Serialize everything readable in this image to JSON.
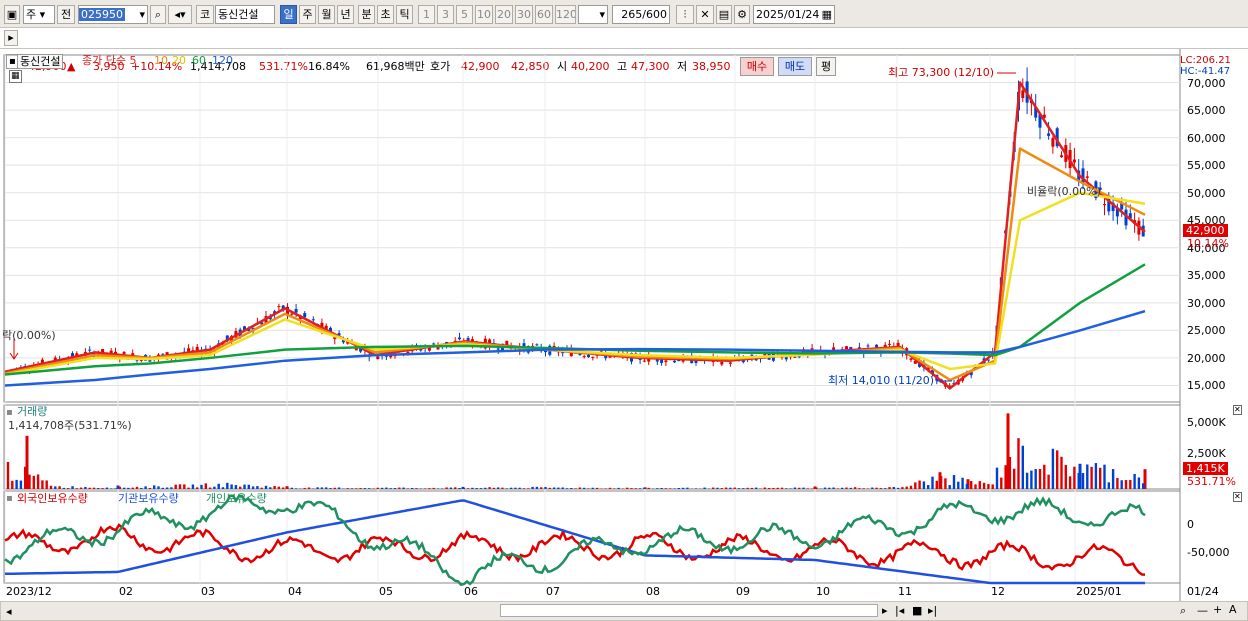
{
  "toolbar": {
    "market": "주",
    "prev_label": "전",
    "code": "025950",
    "exchange_label": "코",
    "stock_name": "동신건설",
    "periods": [
      "일",
      "주",
      "월",
      "년",
      "분",
      "초",
      "틱"
    ],
    "selected_period": "일",
    "intervals": [
      "1",
      "3",
      "5",
      "10",
      "20",
      "30",
      "60",
      "120"
    ],
    "count": "265",
    "count_total": "/600",
    "date": "2025/01/24"
  },
  "quote": {
    "price": "42,900",
    "change": "3,950",
    "change_pct": "+10.14%",
    "volume": "1,414,708",
    "volume_ratio": "531.71%",
    "turnover": "16.84%",
    "amount": "61,968백만",
    "ask_label": "호가",
    "ask": "42,900",
    "bid": "42,850",
    "open_label": "시",
    "open": "40,200",
    "high_label": "고",
    "high": "47,300",
    "low_label": "저",
    "low": "38,950",
    "buy_label": "매수",
    "sell_label": "매도",
    "eval_label": "평"
  },
  "price_panel": {
    "title": "동신건설",
    "ma_label": "종가 단순 5",
    "ma_periods": [
      "10",
      "20",
      "60",
      "120"
    ],
    "lc": "LC:206.21",
    "hc": "HC:-41.47",
    "max_annotation": "최고 73,300 (12/10)",
    "min_annotation": "최저 14,010 (11/20)",
    "ghost_label_right": "비율락(0.00%)",
    "ghost_label_left": "락(0.00%)",
    "y_ticks": [
      "70,000",
      "65,000",
      "60,000",
      "55,000",
      "50,000",
      "45,000",
      "40,000",
      "35,000",
      "30,000",
      "25,000",
      "20,000",
      "15,000"
    ],
    "current_price_tag": "42,900",
    "current_pct_tag": "10.14%"
  },
  "volume_panel": {
    "title": "거래량",
    "value": "1,414,708주(531.71%)",
    "y_ticks": [
      "5,000K",
      "2,500K",
      "0"
    ],
    "current_tag": "1,415K",
    "current_pct": "531.71%"
  },
  "holding_panel": {
    "series": [
      "외국인보유수량",
      "기관보유수량",
      "개인보유수량"
    ],
    "y_ticks": [
      "0",
      "-50,000"
    ]
  },
  "x_axis": {
    "labels": [
      "2023/12",
      "02",
      "03",
      "04",
      "05",
      "06",
      "07",
      "08",
      "09",
      "10",
      "11",
      "12",
      "2025/01"
    ],
    "right_label": "01/24"
  },
  "colors": {
    "up": "#e00000",
    "down": "#0040d0",
    "ma5": "#e02020",
    "ma10": "#f08a10",
    "ma20": "#f0e020",
    "ma60": "#10a040",
    "ma120": "#2060e0",
    "foreign": "#e00000",
    "institution": "#2050e0",
    "individual": "#209060"
  },
  "chart_data": [
    {
      "type": "line",
      "title": "",
      "ylabel": "",
      "ylim": [
        12000,
        75000
      ],
      "x": [
        "2023/12",
        "2024/01",
        "2024/02",
        "2024/03",
        "2024/04",
        "2024/05",
        "2024/06",
        "2024/07",
        "2024/08",
        "2024/09",
        "2024/10",
        "2024/11",
        "2024/11/20",
        "2024/12",
        "2024/12/10",
        "2025/01",
        "2025/01/24"
      ],
      "series": [
        {
          "name": "5",
          "values": [
            17500,
            21000,
            20000,
            21500,
            29000,
            20500,
            23000,
            21500,
            20000,
            19500,
            21000,
            22000,
            14500,
            21000,
            70000,
            53000,
            42900
          ]
        },
        {
          "name": "10",
          "values": [
            17200,
            20500,
            20000,
            21000,
            28000,
            21000,
            22800,
            21500,
            20200,
            19800,
            20800,
            21800,
            16000,
            19500,
            58000,
            52000,
            46000
          ]
        },
        {
          "name": "20",
          "values": [
            17000,
            20000,
            19800,
            20500,
            27000,
            21500,
            22500,
            21500,
            20500,
            20000,
            20600,
            21500,
            18000,
            19000,
            45000,
            50000,
            48000
          ]
        },
        {
          "name": "60",
          "values": [
            17000,
            18500,
            19000,
            20000,
            21500,
            22000,
            22200,
            21800,
            21300,
            21000,
            20800,
            21000,
            20800,
            20500,
            22000,
            30000,
            37000
          ]
        },
        {
          "name": "120",
          "values": [
            15000,
            16000,
            17000,
            18000,
            19500,
            20500,
            21000,
            21500,
            21600,
            21500,
            21300,
            21100,
            21000,
            21000,
            22000,
            25000,
            28500
          ]
        }
      ]
    },
    {
      "type": "bar",
      "title": "",
      "ylabel": "",
      "ylim": [
        0,
        6000
      ],
      "categories": [
        "2023/12",
        "2024/02",
        "2024/04",
        "2024/06",
        "2024/08",
        "2024/10",
        "2024/11",
        "2024/12",
        "2024/12/10",
        "2025/01",
        "2025/01/24"
      ],
      "values": [
        3800,
        250,
        200,
        150,
        120,
        180,
        1200,
        700,
        5400,
        1800,
        1415
      ]
    },
    {
      "type": "line",
      "title": "",
      "ylabel": "",
      "ylim": [
        -80000,
        20000
      ],
      "x": [
        "2023/12",
        "2024/02",
        "2024/04",
        "2024/06",
        "2024/08",
        "2024/10",
        "2024/12",
        "2025/01"
      ],
      "series": [
        {
          "name": "외국인보유수량",
          "values": [
            -40000,
            -30000,
            -45000,
            -40000,
            -40000,
            -45000,
            -50000,
            -55000
          ]
        },
        {
          "name": "기관보유수량",
          "values": [
            -70000,
            -68000,
            -25000,
            10000,
            -50000,
            -55000,
            -80000,
            -80000
          ]
        },
        {
          "name": "개인보유수량",
          "values": [
            -45000,
            -20000,
            10000,
            -70000,
            -35000,
            -30000,
            0,
            -10000
          ]
        }
      ]
    }
  ]
}
